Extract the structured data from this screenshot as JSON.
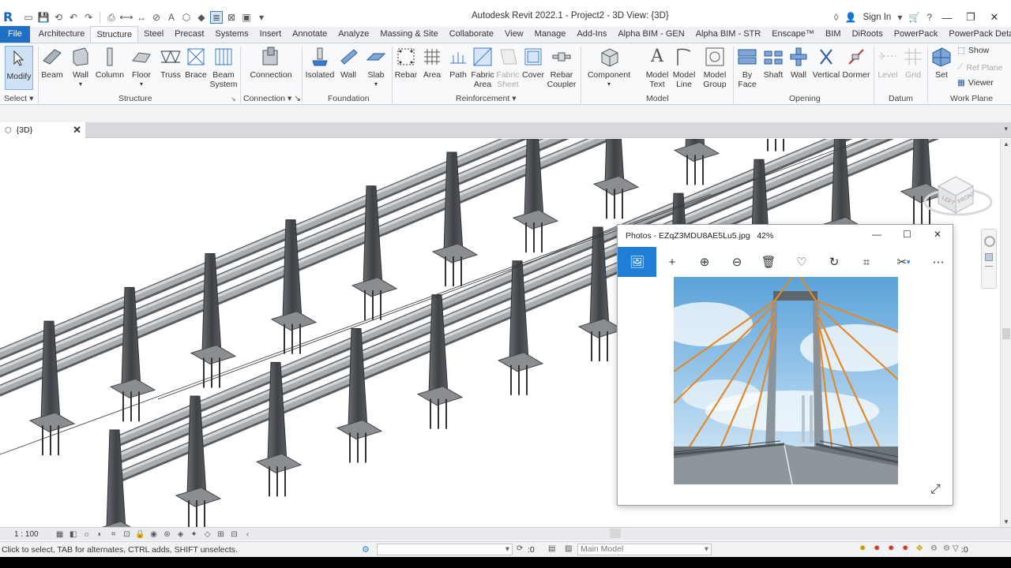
{
  "window": {
    "title": "Autodesk Revit 2022.1 - Project2 - 3D View: {3D}",
    "sign_in": "Sign In",
    "minimize": "—",
    "restore": "❐",
    "close": "✕"
  },
  "tabs": [
    "File",
    "Architecture",
    "Structure",
    "Steel",
    "Precast",
    "Systems",
    "Insert",
    "Annotate",
    "Analyze",
    "Massing & Site",
    "Collaborate",
    "View",
    "Manage",
    "Add-Ins",
    "Alpha BIM - GEN",
    "Alpha BIM - STR",
    "Enscape™",
    "BIM",
    "DiRoots",
    "PowerPack",
    "PowerPack Detailing"
  ],
  "active_tab": "Structure",
  "ribbon": {
    "modify": "Modify",
    "select": "Select",
    "structure": {
      "label": "Structure",
      "items": [
        "Beam",
        "Wall",
        "Column",
        "Floor",
        "Truss",
        "Brace",
        "Beam",
        "System"
      ]
    },
    "connection": {
      "label": "Connection",
      "item": "Connection"
    },
    "foundation": {
      "label": "Foundation",
      "items": [
        "Isolated",
        "Wall",
        "Slab"
      ]
    },
    "reinforcement": {
      "label": "Reinforcement",
      "items": [
        "Rebar",
        "Area",
        "Path",
        "Fabric",
        "Area",
        "Fabric",
        "Sheet",
        "Cover",
        "Rebar",
        "Coupler"
      ]
    },
    "model": {
      "label": "Model",
      "items": [
        "Component",
        "Model",
        "Text",
        "Model",
        "Line",
        "Model",
        "Group"
      ]
    },
    "opening": {
      "label": "Opening",
      "items": [
        "By",
        "Face",
        "Shaft",
        "Wall",
        "Vertical",
        "Dormer"
      ]
    },
    "datum": {
      "label": "Datum",
      "items": [
        "Level",
        "Grid"
      ]
    },
    "workplane": {
      "label": "Work Plane",
      "items": [
        "Set",
        "Show",
        "Ref  Plane",
        "Viewer"
      ]
    }
  },
  "view_tab": "{3D}",
  "view_cube": {
    "top": "LEFT",
    "front": "FRONT"
  },
  "view_control": {
    "scale": "1 : 100"
  },
  "status": {
    "message": "Click to select, TAB for alternates, CTRL adds, SHIFT unselects.",
    "zero1": ":0",
    "model": "Main Model",
    "filter": ":0"
  },
  "photos": {
    "title": "Photos - EZqZ3MDU8AE5Lu5.jpg",
    "zoom": "42%"
  },
  "colors": {
    "accent": "#1f6fc5",
    "photos_accent": "#1f7ed6",
    "rail": "#8a8e92"
  }
}
